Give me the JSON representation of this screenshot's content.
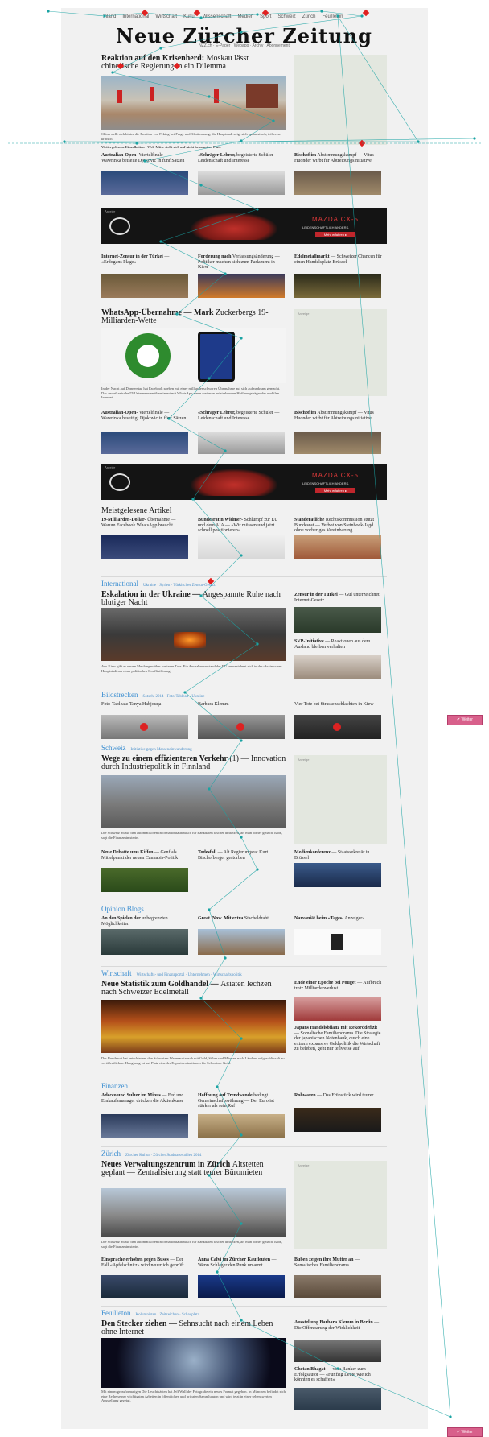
{
  "topnav": [
    "Inland",
    "International",
    "Wirtschaft",
    "Kultur",
    "Wissenschaft",
    "Medien",
    "Sport",
    "Schweiz",
    "Zürich",
    "Feuilleton"
  ],
  "masthead": {
    "title": "Neue Zürcher Zeitung",
    "subnav": "NZZ.ch · E-Paper · Webapp · Archiv · Abonnement"
  },
  "lead": {
    "headline": "Reaktion auf den Krisenherd:",
    "subline": "Moskau lässt chinesische Regierung in ein Dilemma",
    "caption": "China stellt sich hinter die Position von Peking bei Frage und Abstimmung; die Hauptstadt zeigt sich optimistisch, teilweise kritisch.",
    "related": "Weitergelesene Einzelheiten · Web-Mitte stellt sich auf nicht bekanntem Platz"
  },
  "teasers1": [
    {
      "bold": "Australian-Open-",
      "text": "Viertelfinale — Wawrinka beiseite Djokovic in fünf Sätzen"
    },
    {
      "bold": "«Schräger Lehrer,",
      "text": "begeisterte Schüler — Leidenschaft und Interesse"
    },
    {
      "bold": "Bischof im",
      "text": "Abstimmungskampf — Vitus Huonder wirbt für Abtreibungsinitiative"
    }
  ],
  "ad": {
    "label": "Anzeige",
    "brand": "MAZDA CX-5",
    "tagline": "LEIDENSCHAFTLICH ANDERS.",
    "cta": "Mehr erfahren ▸"
  },
  "teasers2": [
    {
      "bold": "Internet-Zensur in der Türkei",
      "text": "— «Erdogans Plage»"
    },
    {
      "bold": "Forderung nach",
      "text": "Verfassungsänderung — Politiker machen sich zum Parlament in Kiew"
    },
    {
      "bold": "Edelmetallmarkt",
      "text": "— Schweizer Chancen für einen Handelsplatz Brüssel"
    }
  ],
  "story2": {
    "headline": "WhatsApp-Übernahme — Mark",
    "subline": "Zuckerbergs 19-Milliarden-Wette",
    "caption": "In der Nacht auf Donnerstag hat Facebook soeben mit einer milliardenschweren Übernahme auf sich aufmerksam gemacht. Das amerikanische IT-Unternehmen übernimmt mit WhatsApp einen weiteren aufstrebenden Hoffnungsträger des mobilen Internet."
  },
  "teasers3": [
    {
      "bold": "Australian-Open-",
      "text": "Viertelfinale — Wawrinka beseitigt Djokovic in fünf Sätzen"
    },
    {
      "bold": "«Schräger Lehrer,",
      "text": "begeisterte Schüler — Leidenschaft und Interesse"
    },
    {
      "bold": "Bischof im",
      "text": "Abstimmungskampf — Vitus Huonder wirbt für Abtreibungsinitiative"
    }
  ],
  "mostread": {
    "title": "Meistgelesene Artikel",
    "items": [
      {
        "bold": "19-Milliarden-Dollar-",
        "text": "Übernahme — Warum Facebook WhatsApp braucht"
      },
      {
        "bold": "Bundesrätin Widmer-",
        "text": "Schlumpf zur EU und dem AIA — «Wir müssen und jetzt schnell positionieren»"
      },
      {
        "bold": "Ständerätliche",
        "text": "Rechtskommission stützt Bundesrat — Verbot von Steinbock-Jagd ohne vorheriges Vereinbarung"
      }
    ]
  },
  "international": {
    "section": "International",
    "links": "Ukraine · Syrien · Türkisches Zensur-Gesetz",
    "headline": "Eskalation in der Ukraine —",
    "subline": "Angespannte Ruhe nach blutiger Nacht",
    "caption": "Aus Kiew gibt es neuen Meldungen über weiteren Tote. Ein Ausnahmezustand der EU kennzeichnet sich in der ukrainischen Hauptstadt am einer politischen Konfliktlösung.",
    "side": [
      {
        "bold": "Zensur in der Türkei",
        "text": "— Gül unterzeichnet Internet-Gesetz"
      },
      {
        "bold": "SVP-Initiative",
        "text": "— Reaktionen aus dem Ausland bleiben verhalten"
      }
    ]
  },
  "bildstrecken": {
    "section": "Bildstrecken",
    "links": "Sotschi 2014 · Foto-Tableau · Ukraine",
    "items": [
      {
        "text": "Foto-Tableau: Tanya Habjouqa"
      },
      {
        "text": "Barbara Klemm"
      },
      {
        "text": "Vier Tote bei Strassenschlachten in Kiew"
      }
    ]
  },
  "schweiz": {
    "section": "Schweiz",
    "links": "Initiative gegen Masseneinwanderung",
    "headline": "Wege zu einem effizienteren Verkehr",
    "subline": "(1) — Innovation durch Industriepolitik in Finnland",
    "caption": "Die Schweiz müsse den automatischen Informationsaustausch für Bankdaten rascher umsetzen, als man bisher gedacht habe, sagt die Finanzministerin.",
    "teasers": [
      {
        "bold": "Neue Debatte ums Kiffen",
        "text": "— Genf als Mittelpunkt der neuen Cannabis-Politik"
      },
      {
        "bold": "Todesfall",
        "text": "— Alt Regierungsrat Kurt Bischofberger gestorben"
      },
      {
        "bold": "Medienkonferenz",
        "text": "— Staatssekretär in Brüssel"
      }
    ]
  },
  "blogs": {
    "section": "Opinion Blogs",
    "items": [
      {
        "bold": "An den Spielen der",
        "text": "unbegrenzten Möglichkeiten"
      },
      {
        "bold": "Great. Now. Mit extra",
        "text": "Stacheldraht"
      },
      {
        "bold": "Narvaniät beim «Tages-",
        "text": "Anzeiger»"
      }
    ]
  },
  "wirtschaft": {
    "section": "Wirtschaft",
    "links": "Wirtschafts- und Finanzportal · Unternehmen · Wirtschaftspolitik",
    "headline": "Neue Statistik zum Goldhandel —",
    "subline": "Asiaten lechzen nach Schweizer Edelmetall",
    "caption": "Der Bundesrat hat entschieden, den Schweizer Warenaustausch mit Gold, Silber und Münzen nach Ländern aufgeschlüsselt zu veröffentlichen. Hongkong ist auf Platz eins der Exportdestinationen für Schweizer Gold.",
    "side": [
      {
        "bold": "Ende einer Epoche bei Pouget",
        "text": "— Aufbruch trotz Milliardenverlust"
      },
      {
        "bold": "Japans Handelsbilanz mit Rekorddefizit",
        "text": "— Somalische Familiendrama. Die Strategie der japanischen Notenbank, durch eine extrem expansive Geldpolitik die Wirtschaft zu beleben, geht nur teilweise auf."
      }
    ]
  },
  "finanzen": {
    "section": "Finanzen",
    "items": [
      {
        "bold": "Adecco und Sulzer im Minus",
        "text": "— Fed und Einkaufsmanager drücken die Aktienkurse"
      },
      {
        "bold": "Hoffnung auf Trendwende",
        "text": "bedingt Gemeinschaftswährung — Der Euro ist stärker als sein Ruf"
      },
      {
        "bold": "Rohwaren",
        "text": "— Das Frühstück wird teurer"
      }
    ]
  },
  "zuerich": {
    "section": "Zürich",
    "links": "Zürcher Kultur · Zürcher Stadtratswahlen 2014",
    "headline": "Neues Verwaltungszentrum in Zürich",
    "subline": "Altstetten geplant — Zentralisierung statt teurer Büromieten",
    "caption": "Die Schweiz müsse den automatischen Informationsaustausch für Bankdaten rascher umsetzen, als man bisher gedacht habe, sagt die Finanzministerin.",
    "teasers": [
      {
        "bold": "Einsprache erhoben gegen Buses",
        "text": "— Der Fall «Apfelschnitz» wird neuerlich geprüft"
      },
      {
        "bold": "Anna Calvi im Zürcher Kaufleuten",
        "text": "— Wenn Schlager den Punk umarmt"
      },
      {
        "bold": "Buben zeigen ihre Mutter an",
        "text": "— Somalisches Familiendrama"
      }
    ]
  },
  "feuilleton": {
    "section": "Feuilleton",
    "links": "Kolumnisten · Zeitzeichen · Schauplatz",
    "headline": "Den Stecker ziehen —",
    "subline": "Sehnsucht nach einem Leben ohne Internet",
    "caption": "Mit einem grossformatigen Die Leuchtkästen hat Jeff Wall der Fotografie ein neues Format gegeben. In München befindet sich eine Reihe seiner wichtigsten Arbeiten in öffentlichen und privaten Sammlungen und wird jetzt in einer sehenswerten Ausstellung gezeigt.",
    "side": [
      {
        "bold": "Ausstellung Barbara Klemm in Berlin",
        "text": "— Die Offenbarung der Wirklichkeit"
      },
      {
        "bold": "Chetan Bhagat",
        "text": "— vom Banker zum Erfolgsautor — «Fünfzig Leute wie ich könnten es schaffen»"
      }
    ]
  },
  "scroll_button": "✔ Weiter",
  "colors": {
    "accent": "#3d8fd1",
    "page_bg": "#f1f1f1",
    "ad_rail": "#e3e7df",
    "trace": "#1aa3a3",
    "marker": "#e02020"
  }
}
